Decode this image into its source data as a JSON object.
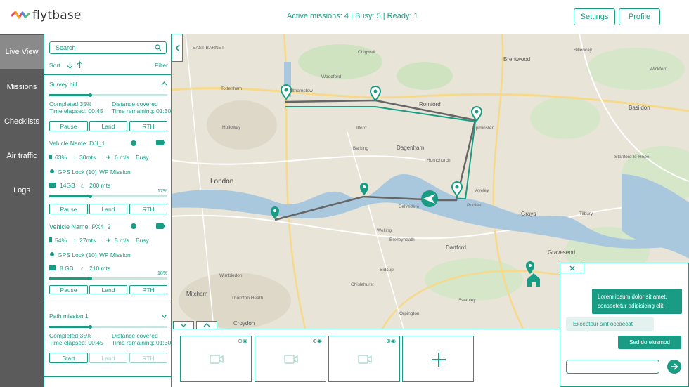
{
  "header": {
    "brand": "flytbase",
    "status": "Active missions: 4 | Busy: 5 | Ready: 1",
    "settings_label": "Settings",
    "profile_label": "Profile"
  },
  "nav": {
    "items": [
      {
        "label": "Live View"
      },
      {
        "label": "Missions"
      },
      {
        "label": "Checklists"
      },
      {
        "label": "Air traffic"
      },
      {
        "label": "Logs"
      }
    ]
  },
  "panel": {
    "search_placeholder": "Search",
    "sort_label": "Sort",
    "filter_label": "Filter",
    "missions": [
      {
        "title": "Survey hill",
        "completed": "Completed 35%",
        "distance": "Distance covered",
        "elapsed": "Time elapsed: 00:45",
        "remaining": "Time remaining: 01:30",
        "progress": 0.35,
        "buttons": [
          "Pause",
          "Land",
          "RTH"
        ]
      }
    ],
    "vehicles": [
      {
        "name": "Vehicle Name: DJI_1",
        "battery": "63%",
        "altitude": "30mts",
        "speed": "6 m/s",
        "state": "Busy",
        "gps": "GPS Lock (10)",
        "mode": "WP Mission",
        "storage": "14GB",
        "home_distance": "200 mts",
        "pct_label": "17%",
        "progress": 0.17,
        "buttons": [
          "Pause",
          "Land",
          "RTH"
        ]
      },
      {
        "name": "Vehicle Name: PX4_2",
        "battery": "54%",
        "altitude": "27mts",
        "speed": "5 m/s",
        "state": "Busy",
        "gps": "GPS Lock (10)",
        "mode": "WP Mission",
        "storage": "8 GB",
        "home_distance": "210 mts",
        "pct_label": "18%",
        "progress": 0.18,
        "buttons": [
          "Pause",
          "Land",
          "RTH"
        ]
      }
    ],
    "path_mission": {
      "title": "Path mission 1",
      "completed": "Completed 35%",
      "distance": "Distance covered",
      "elapsed": "Time elapsed: 00:45",
      "remaining": "Time remaining: 01:30",
      "progress": 0.35,
      "buttons": [
        "Start",
        "Land",
        "RTH"
      ]
    }
  },
  "map": {
    "labels": {
      "london": "London",
      "romford": "Romford",
      "dagenham": "Dagenham",
      "dartford": "Dartford",
      "grays": "Grays",
      "brentwood": "Brentwood",
      "basildon": "Basildon",
      "gravesend": "Gravesend",
      "woodford": "Woodford",
      "ilford": "Ilford",
      "barking": "Barking",
      "chigwell": "Chigwell",
      "croydon": "Croydon",
      "mitcham": "Mitcham",
      "bexleyheath": "Bexleyheath",
      "belvedere": "Belvedere",
      "upminster": "Upminster",
      "billericay": "Billericay",
      "wickford": "Wickford",
      "aveley": "Aveley",
      "purfleet": "Purfleet",
      "welling": "Welling",
      "sidcup": "Sidcup",
      "orpington": "Orpington",
      "tilbury": "Tilbury",
      "hornchurch": "Hornchurch",
      "walthamstow": "Walthamstow",
      "tottenham": "Tottenham",
      "holloway": "Holloway",
      "east_barnet": "EAST BARNET",
      "wimbledon": "Wimbledon",
      "thornton_heath": "Thornton Heath",
      "stanford": "Stanford-le-Hope",
      "chislehurst": "Chislehurst",
      "swanley": "Swanley"
    }
  },
  "chat": {
    "messages": [
      {
        "dir": "out",
        "text": "Lorem ipsum dolor sit amet, consectetur adipisicing elit,"
      },
      {
        "dir": "in",
        "text": "Excepteur sint occaecat"
      },
      {
        "dir": "out",
        "text": "Sed do eiusmod"
      }
    ]
  },
  "colors": {
    "accent": "#1a9c84",
    "nav_bg": "#5b5b5b",
    "nav_active": "#8a8a8a",
    "water": "#a9c8de",
    "route_gray": "#666666"
  },
  "icons": {
    "search": "search-icon",
    "camera": "video-camera-icon",
    "add": "plus-icon",
    "send": "arrow-right-icon",
    "home": "home-icon",
    "waypoint": "map-pin-icon",
    "drone": "drone-arrow-icon"
  }
}
